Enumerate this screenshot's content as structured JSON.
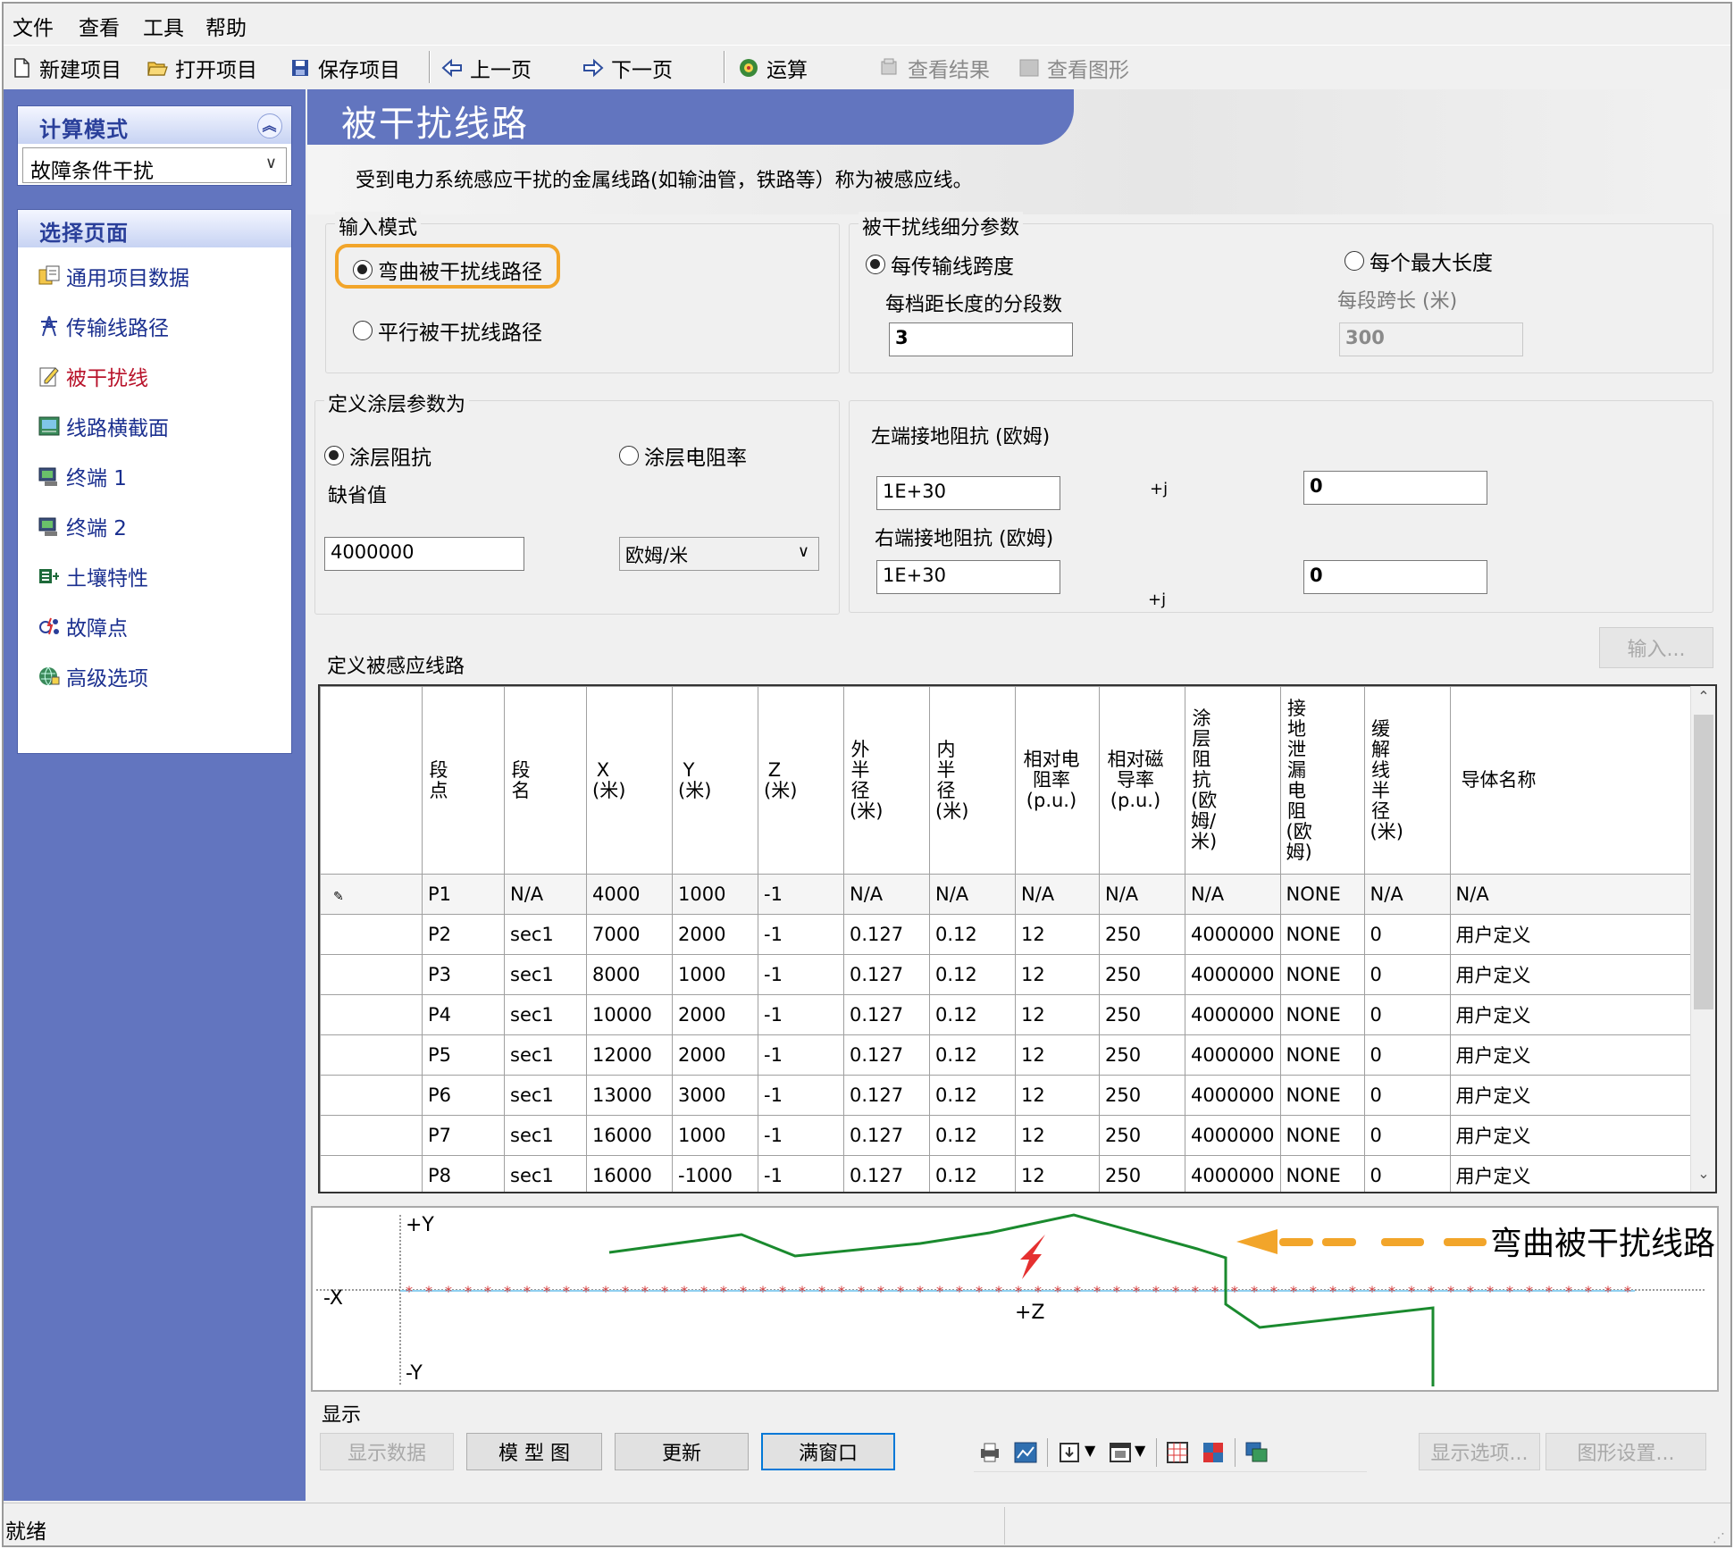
{
  "menu": {
    "file": "文件",
    "view": "查看",
    "tools": "工具",
    "help": "帮助"
  },
  "toolbar": {
    "new_project": "新建项目",
    "open_project": "打开项目",
    "save_project": "保存项目",
    "prev_page": "上一页",
    "next_page": "下一页",
    "run": "运算",
    "view_results": "查看结果",
    "view_graphics": "查看图形"
  },
  "sidebar": {
    "calc_mode_title": "计算模式",
    "calc_mode_value": "故障条件干扰",
    "select_page_title": "选择页面",
    "items": [
      {
        "label": "通用项目数据",
        "icon": "project-data-icon"
      },
      {
        "label": "传输线路径",
        "icon": "transmission-tower-icon"
      },
      {
        "label": "被干扰线",
        "icon": "edit-document-icon"
      },
      {
        "label": "线路横截面",
        "icon": "cross-section-icon"
      },
      {
        "label": "终端 1",
        "icon": "terminal-icon"
      },
      {
        "label": "终端 2",
        "icon": "terminal-icon"
      },
      {
        "label": "土壤特性",
        "icon": "soil-icon"
      },
      {
        "label": "故障点",
        "icon": "fault-point-icon"
      },
      {
        "label": "高级选项",
        "icon": "advanced-options-icon"
      }
    ],
    "active_index": 2
  },
  "page": {
    "title": "被干扰线路",
    "description": "受到电力系统感应干扰的金属线路(如输油管，铁路等）称为被感应线。"
  },
  "input_mode": {
    "legend": "输入模式",
    "options": [
      "弯曲被干扰线路径",
      "平行被干扰线路径"
    ],
    "selected": 0
  },
  "subdivision": {
    "legend": "被干扰线细分参数",
    "option_span": "每传输线跨度",
    "option_maxlen": "每个最大长度",
    "selected": "span",
    "segments_label": "每档距长度的分段数",
    "segments_value": "3",
    "seg_length_label": "每段跨长 (米)",
    "seg_length_value": "300"
  },
  "coating": {
    "legend": "定义涂层参数为",
    "option_impedance": "涂层阻抗",
    "option_resistivity": "涂层电阻率",
    "selected": "impedance",
    "default_label": "缺省值",
    "default_value": "4000000",
    "unit_value": "欧姆/米"
  },
  "grounding": {
    "left_label": "左端接地阻抗 (欧姆)",
    "left_real": "1E+30",
    "left_imag": "0",
    "right_label": "右端接地阻抗 (欧姆)",
    "right_real": "1E+30",
    "right_imag": "0",
    "j_symbol": "+j"
  },
  "input_button": "输入...",
  "induced_lines": {
    "title": "定义被感应线路",
    "columns": [
      "段点",
      "段名",
      "X(米)",
      "Y(米)",
      "Z(米)",
      "外半径(米)",
      "内半径(米)",
      "相对电阻率(p.u.)",
      "相对磁导率(p.u.)",
      "涂层阻抗(欧姆/米)",
      "接地泄漏电阻(欧姆)",
      "缓解线半径(米)",
      "导体名称"
    ],
    "rows": [
      [
        "P1",
        "N/A",
        "4000",
        "1000",
        "-1",
        "N/A",
        "N/A",
        "N/A",
        "N/A",
        "N/A",
        "NONE",
        "N/A",
        "N/A"
      ],
      [
        "P2",
        "sec1",
        "7000",
        "2000",
        "-1",
        "0.127",
        "0.12",
        "12",
        "250",
        "4000000",
        "NONE",
        "0",
        "用户定义"
      ],
      [
        "P3",
        "sec1",
        "8000",
        "1000",
        "-1",
        "0.127",
        "0.12",
        "12",
        "250",
        "4000000",
        "NONE",
        "0",
        "用户定义"
      ],
      [
        "P4",
        "sec1",
        "10000",
        "2000",
        "-1",
        "0.127",
        "0.12",
        "12",
        "250",
        "4000000",
        "NONE",
        "0",
        "用户定义"
      ],
      [
        "P5",
        "sec1",
        "12000",
        "2000",
        "-1",
        "0.127",
        "0.12",
        "12",
        "250",
        "4000000",
        "NONE",
        "0",
        "用户定义"
      ],
      [
        "P6",
        "sec1",
        "13000",
        "3000",
        "-1",
        "0.127",
        "0.12",
        "12",
        "250",
        "4000000",
        "NONE",
        "0",
        "用户定义"
      ],
      [
        "P7",
        "sec1",
        "16000",
        "1000",
        "-1",
        "0.127",
        "0.12",
        "12",
        "250",
        "4000000",
        "NONE",
        "0",
        "用户定义"
      ],
      [
        "P8",
        "sec1",
        "16000",
        "-1000",
        "-1",
        "0.127",
        "0.12",
        "12",
        "250",
        "4000000",
        "NONE",
        "0",
        "用户定义"
      ]
    ]
  },
  "diagram": {
    "label_plus_y": "+Y",
    "label_minus_y": "-Y",
    "label_x": "-X",
    "label_plus_z": "+Z",
    "annotation": "弯曲被干扰线路",
    "colors": {
      "induced_line": "#1a8a2e",
      "transmission": "#d33a3a",
      "annotation": "#f2a52a",
      "fault": "#e53030"
    }
  },
  "display": {
    "legend": "显示",
    "show_data": "显示数据",
    "model_view": "模 型 图",
    "refresh": "更新",
    "full_window": "满窗口",
    "show_options": "显示选项...",
    "graph_settings": "图形设置..."
  },
  "status": {
    "text": "就绪"
  }
}
